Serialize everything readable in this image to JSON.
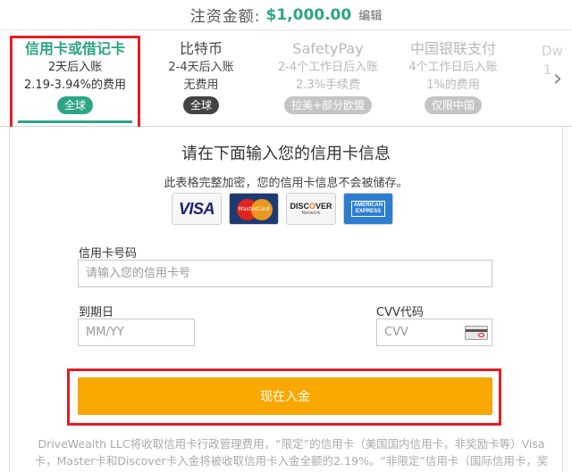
{
  "header": {
    "label": "注资金额:",
    "amount": "$1,000.00",
    "edit": "编辑"
  },
  "tabs": [
    {
      "name": "信用卡或借记卡",
      "line1": "2天后入账",
      "line2": "2.19-3.94%的费用",
      "badge": "全球",
      "state": "active"
    },
    {
      "name": "比特币",
      "line1": "2-4天后入账",
      "line2": "无费用",
      "badge": "全球",
      "state": "normal"
    },
    {
      "name": "SafetyPay",
      "line1": "2-4个工作日后入账",
      "line2": "2.3%手续费",
      "badge": "拉美+部分欧盟",
      "state": "faded"
    },
    {
      "name": "中国银联支付",
      "line1": "4个工作日后入账",
      "line2": "1%的费用",
      "badge": "仅限中国",
      "state": "faded"
    }
  ],
  "edge_tab": {
    "name": "Dw",
    "line1": "1",
    "line2": ""
  },
  "nav": {
    "next": "›"
  },
  "form": {
    "title": "请在下面输入您的信用卡信息",
    "subtitle": "此表格完整加密，您的信用卡信息不会被储存。",
    "card_number_label": "信用卡号码",
    "card_number_placeholder": "请输入您的信用卡号",
    "expiry_label": "到期日",
    "expiry_placeholder": "MM/YY",
    "cvv_label": "CVV代码",
    "cvv_placeholder": "CVV",
    "submit": "现在入金"
  },
  "card_logos": {
    "visa": "VISA",
    "master": "MasterCard",
    "discover_a": "DISC",
    "discover_o": "O",
    "discover_b": "VER",
    "discover_net": "Network",
    "amex_a": "AMERICAN",
    "amex_b": "EXPRESS"
  },
  "disclaimer": "DriveWealth LLC将收取信用卡行政管理费用，“限定”的信用卡（美国国内信用卡，非奖励卡等）Visa卡，Master卡和Discover卡入金将被收取信用卡入金全额的2.19%。“非限定”信用卡（国际信用卡，奖励卡等）Visa卡，Master卡和Discover卡入金将被收取信用卡入金金额的最",
  "colors": {
    "accent": "#2ba585",
    "button": "#f8a800",
    "highlight": "#e51c23"
  }
}
